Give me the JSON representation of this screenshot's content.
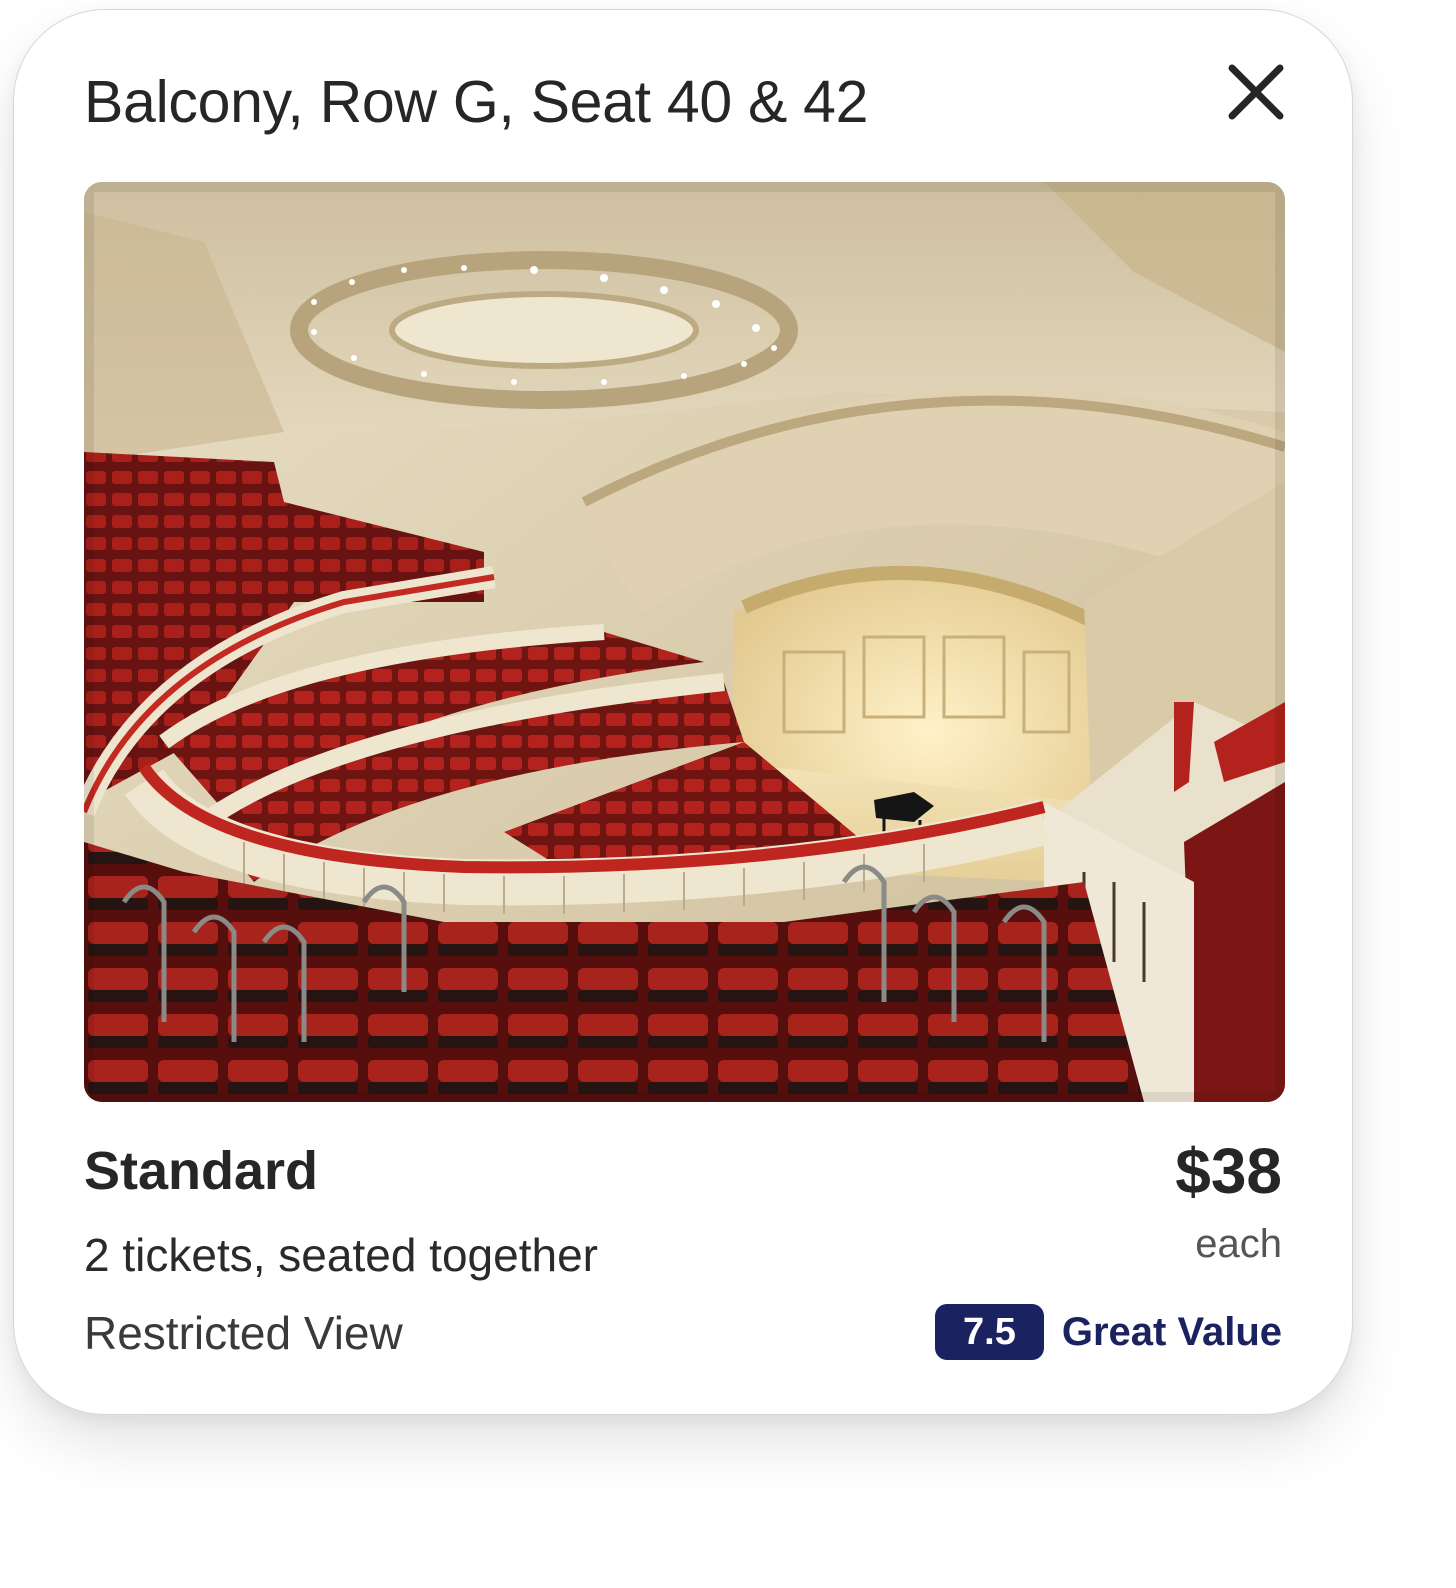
{
  "header": {
    "title": "Balcony, Row G, Seat 40 & 42",
    "close_icon": "close-icon"
  },
  "photo": {
    "subject": "concert-hall-view-from-seat"
  },
  "listing": {
    "tier": "Standard",
    "ticket_summary": "2 tickets, seated together",
    "restriction": "Restricted View",
    "price": "$38",
    "price_unit": "each",
    "rating_score": "7.5",
    "rating_label": "Great Value"
  },
  "colors": {
    "text_primary": "#262626",
    "accent_navy": "#1a2260",
    "seat_red": "#b3221c",
    "hall_cream": "#e8dcc0"
  }
}
